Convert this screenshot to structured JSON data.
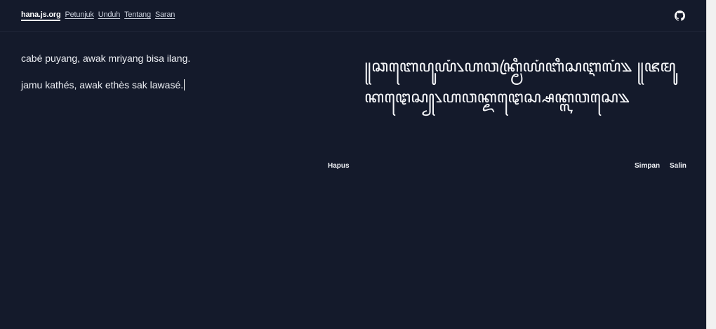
{
  "nav": {
    "brand": "hana.js.org",
    "links": [
      "Petunjuk",
      "Unduh",
      "Tentang",
      "Saran"
    ]
  },
  "header": {
    "github_icon": "github-icon"
  },
  "editor": {
    "lines": [
      "cabé puyang, awak mriyang bisa ilang.",
      "jamu kathés, awak ethès sak lawasé."
    ]
  },
  "output": {
    "text": "꧋ꦕꦧꦺꦥꦸꦪꦁ꧈ꦲꦮꦏ꧀ꦩꦿꦶꦪꦁꦧꦶꦱꦆꦭꦁ꧉ ꧋ꦗꦩꦸꦏꦛꦺꦱ꧀꧈ꦲꦮꦏ꧀ꦌꦛꦺꦱ꧀ꦱꦏ꧀ꦭꦮꦱꦺ꧉"
  },
  "actions": {
    "clear": "Hapus",
    "save": "Simpan",
    "copy": "Salin"
  },
  "colors": {
    "background": "#141a2b",
    "text": "#e8ebf2"
  }
}
